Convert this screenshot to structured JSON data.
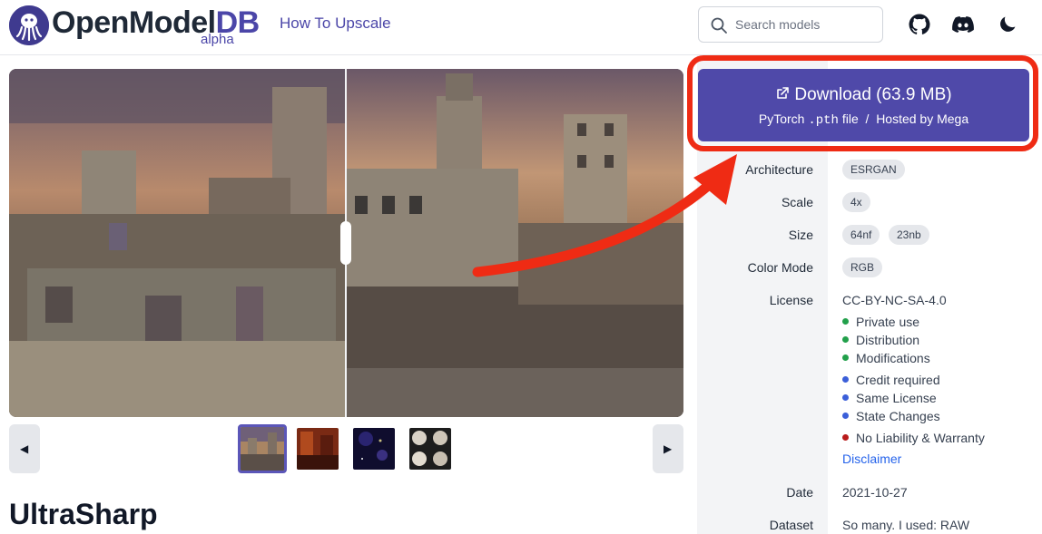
{
  "header": {
    "brand_main": "OpenModel",
    "brand_accent": "DB",
    "brand_tag": "alpha",
    "nav_link": "How To Upscale",
    "search_placeholder": "Search models",
    "icons": [
      "github-icon",
      "discord-icon",
      "moon-icon"
    ]
  },
  "gallery": {
    "prev_glyph": "◀",
    "next_glyph": "▶",
    "thumbnails": [
      "castle",
      "red-interior",
      "night-sky",
      "clouds-grid"
    ],
    "selected_index": 0
  },
  "model": {
    "title": "UltraSharp"
  },
  "download": {
    "label": "Download (63.9 MB)",
    "format_prefix": "PyTorch",
    "format_ext": ".pth",
    "format_suffix": "file",
    "separator": "/",
    "hosted": "Hosted by Mega"
  },
  "details": {
    "architecture_label": "Architecture",
    "architecture_value": "ESRGAN",
    "scale_label": "Scale",
    "scale_value": "4x",
    "size_label": "Size",
    "size_values": [
      "64nf",
      "23nb"
    ],
    "color_mode_label": "Color Mode",
    "color_mode_value": "RGB",
    "license_label": "License",
    "license_value": "CC-BY-NC-SA-4.0",
    "permissions": [
      {
        "text": "Private use",
        "color": "#22a04b"
      },
      {
        "text": "Distribution",
        "color": "#22a04b"
      },
      {
        "text": "Modifications",
        "color": "#22a04b"
      },
      {
        "text": "Credit required",
        "color": "#3b5fd9"
      },
      {
        "text": "Same License",
        "color": "#3b5fd9"
      },
      {
        "text": "State Changes",
        "color": "#3b5fd9"
      },
      {
        "text": "No Liability & Warranty",
        "color": "#b91c1c"
      }
    ],
    "disclaimer": "Disclaimer",
    "date_label": "Date",
    "date_value": "2021-10-27",
    "dataset_label": "Dataset",
    "dataset_value": "So many. I used: RAW"
  },
  "colors": {
    "accent": "#4f49a9",
    "highlight": "#ef2b14"
  }
}
